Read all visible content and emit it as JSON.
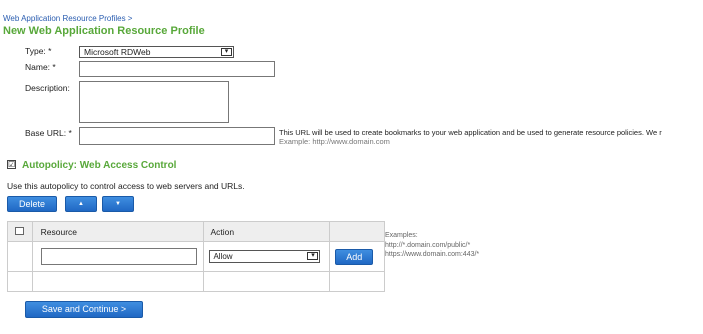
{
  "breadcrumb": "Web Application Resource Profiles >",
  "page_title": "New Web Application Resource Profile",
  "form": {
    "type_label": "Type: *",
    "type_value": "Microsoft RDWeb",
    "name_label": "Name: *",
    "name_value": "",
    "description_label": "Description:",
    "description_value": "",
    "base_url_label": "Base URL: *",
    "base_url_value": "",
    "base_url_help": "This URL will be used to create bookmarks to your web application and be used to generate resource policies. We r",
    "base_url_example": "Example: http://www.domain.com"
  },
  "autopolicy": {
    "checked": true,
    "checkbox_mark": "☑",
    "title": "Autopolicy: Web Access Control",
    "description": "Use this autopolicy to control access to web servers and URLs.",
    "delete_label": "Delete",
    "up_icon": "▲",
    "down_icon": "▼",
    "table": {
      "col_resource": "Resource",
      "col_action": "Action",
      "resource_value": "",
      "action_value": "Allow",
      "add_label": "Add"
    },
    "examples": [
      "Examples:",
      "http://*.domain.com/public/*",
      "https://www.domain.com:443/*"
    ]
  },
  "save_label": "Save and Continue >",
  "colors": {
    "accent_green": "#58a83a",
    "button_blue": "#2a76d2",
    "link_blue": "#2a5db0"
  }
}
